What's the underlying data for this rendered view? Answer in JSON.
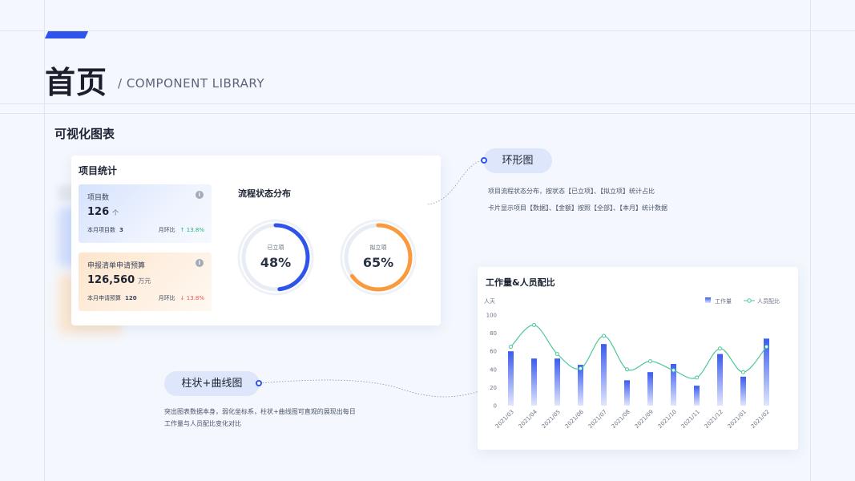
{
  "header": {
    "title": "首页",
    "subtitle": "/ COMPONENT LIBRARY"
  },
  "section": {
    "title": "可视化图表"
  },
  "project_card": {
    "title": "项目统计",
    "stats": [
      {
        "label": "项目数",
        "value": "126",
        "unit": "个",
        "foot_label": "本月项目数",
        "foot_value": "3",
        "trend_label": "月环比",
        "trend_value": "↑ 13.8%",
        "trend_dir": "up",
        "info_icon": "info-icon"
      },
      {
        "label": "申报清单申请预算",
        "value": "126,560",
        "unit": "万元",
        "foot_label": "本月申请预算",
        "foot_value": "120",
        "trend_label": "月环比",
        "trend_value": "↓ 13.8%",
        "trend_dir": "down",
        "info_icon": "info-icon"
      }
    ],
    "flow": {
      "title": "流程状态分布",
      "donuts": [
        {
          "label": "已立项",
          "value_text": "48%",
          "percent": 48,
          "color": "#2f54eb"
        },
        {
          "label": "拟立项",
          "value_text": "65%",
          "percent": 65,
          "color": "#fa9a3c"
        }
      ]
    }
  },
  "ring_note": {
    "pill": "环形图",
    "lines": [
      "项目流程状态分布，按状态【已立项】、【拟立项】统计占比",
      "卡片显示项目【数据】、【金额】按照【全部】、【本月】统计数据"
    ]
  },
  "bar_note": {
    "pill": "柱状+曲线图",
    "lines": [
      "突出图表数据本身，弱化坐标系，柱状+曲线图可直观的展现出每日",
      "工作量与人员配比变化对比"
    ]
  },
  "workload_card": {
    "title": "工作量&人员配比",
    "chart_data": {
      "type": "bar",
      "title": "工作量&人员配比",
      "ylabel": "人天",
      "ylim": [
        0,
        100
      ],
      "yticks": [
        0,
        20,
        40,
        60,
        80,
        100
      ],
      "categories": [
        "2021/03",
        "2021/04",
        "2021/05",
        "2021/06",
        "2021/07",
        "2021/08",
        "2021/09",
        "2021/10",
        "2021/11",
        "2021/12",
        "2021/01",
        "2021/02"
      ],
      "series": [
        {
          "name": "工作量",
          "type": "bar",
          "color": "#3a5bef",
          "values": [
            60,
            52,
            52,
            45,
            68,
            28,
            37,
            46,
            22,
            57,
            32,
            74
          ]
        },
        {
          "name": "人员配比",
          "type": "line",
          "color": "#4cc79a",
          "values": [
            65,
            89,
            57,
            41,
            77,
            40,
            49,
            39,
            31,
            63,
            37,
            65
          ]
        }
      ],
      "legend_position": "top-right",
      "grid": false
    }
  }
}
